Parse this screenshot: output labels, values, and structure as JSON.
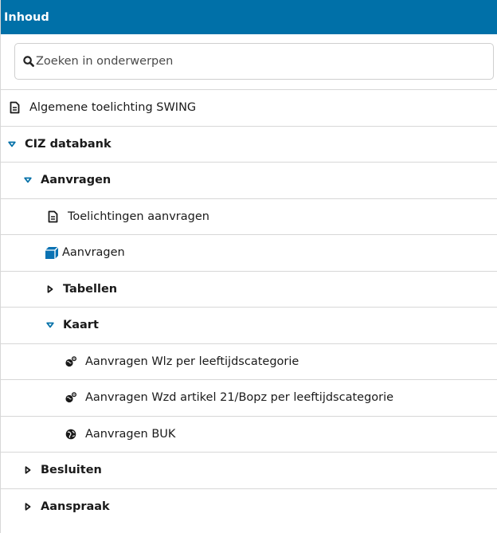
{
  "header": {
    "title": "Inhoud"
  },
  "search": {
    "placeholder": "Zoeken in onderwerpen"
  },
  "tree": {
    "items": [
      {
        "label": "Algemene toelichting SWING"
      },
      {
        "label": "CIZ databank"
      },
      {
        "label": "Aanvragen"
      },
      {
        "label": "Toelichtingen aanvragen"
      },
      {
        "label": "Aanvragen"
      },
      {
        "label": "Tabellen"
      },
      {
        "label": "Kaart"
      },
      {
        "label": "Aanvragen Wlz per leeftijdscategorie"
      },
      {
        "label": "Aanvragen Wzd artikel 21/Bopz per leeftijdscategorie"
      },
      {
        "label": "Aanvragen BUK"
      },
      {
        "label": "Besluiten"
      },
      {
        "label": "Aanspraak"
      }
    ]
  },
  "colors": {
    "header_bg": "#0070a8",
    "cube_icon": "#0a72b3",
    "border": "#d7d7d7"
  }
}
